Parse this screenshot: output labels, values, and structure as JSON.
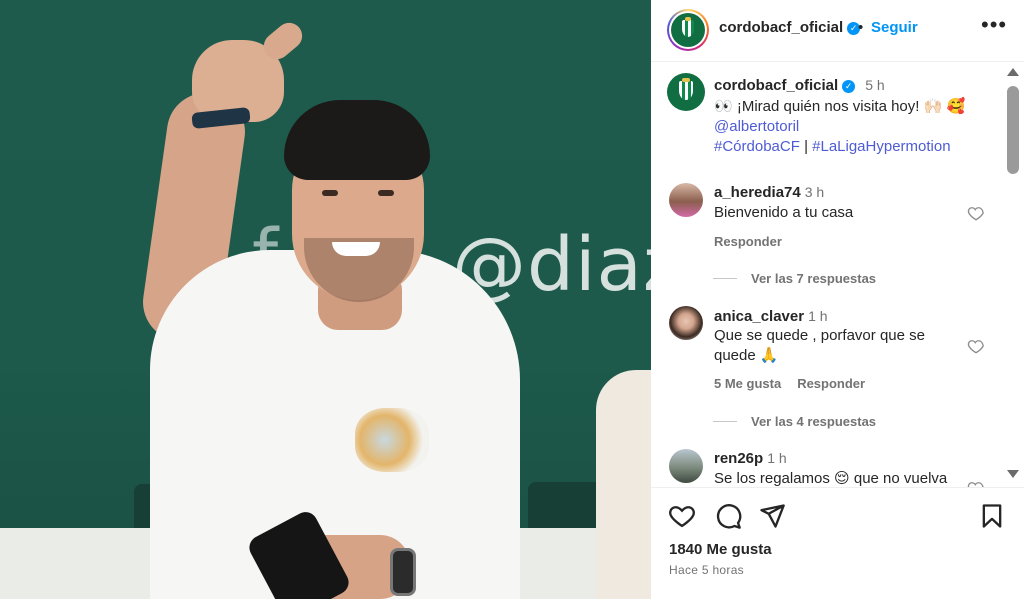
{
  "post": {
    "username": "cordobacf_oficial",
    "verified_mark": "✓",
    "follow_label": "Seguir",
    "separator": "•",
    "more_label": "•••",
    "photo_wall_text": "@diazf",
    "photo_wall_text_left": "f"
  },
  "caption": {
    "username": "cordobacf_oficial",
    "time": "5 h",
    "emoji_eyes": "👀",
    "text": "¡Mirad quién nos visita hoy!",
    "emoji_end": "🙌🏻 🥰",
    "mention": "@albertotoril",
    "hashtag1": "#CórdobaCF",
    "divider": "|",
    "hashtag2": "#LaLigaHypermotion"
  },
  "comments": [
    {
      "username": "a_heredia74",
      "time": "3 h",
      "text": "Bienvenido a tu casa",
      "reply_label": "Responder",
      "view_replies": "Ver las 7 respuestas"
    },
    {
      "username": "anica_claver",
      "time": "1 h",
      "text": "Que se quede , porfavor que se quede 🙏",
      "likes_label": "5 Me gusta",
      "reply_label": "Responder",
      "view_replies": "Ver las 4 respuestas"
    },
    {
      "username": "ren26p",
      "time": "1 h",
      "text": "Se los regalamos 😌 que no vuelva"
    }
  ],
  "footer": {
    "likes": "1840 Me gusta",
    "posted_ago": "Hace 5 horas"
  },
  "icons": [
    "heart-icon",
    "comment-icon",
    "share-icon",
    "bookmark-icon",
    "more-icon",
    "verified-icon"
  ],
  "colors": {
    "accent_blue": "#0095f6",
    "text": "#262626",
    "muted": "#737373",
    "crest_green": "#116e43",
    "wall_green": "#1e5b4c"
  }
}
